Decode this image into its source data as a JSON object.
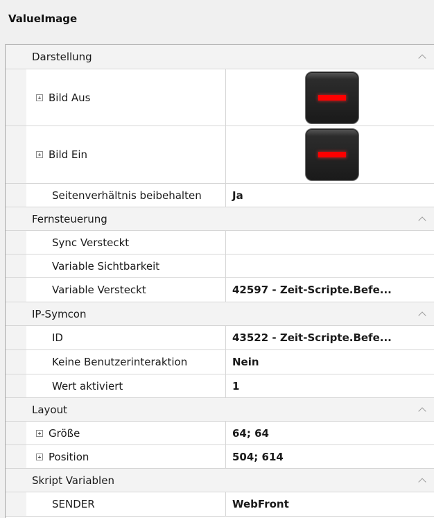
{
  "window": {
    "title": "ValueImage"
  },
  "colors": {
    "background": "#f0f0f0",
    "category_bg": "#f3f3f3",
    "grid_line": "#d6d6d6",
    "indicator": "#ff0000"
  },
  "categories": [
    {
      "label": "Darstellung",
      "properties": [
        {
          "name": "Bild Aus",
          "value": "",
          "expandable": true,
          "value_icon": "red-bar-tile-icon"
        },
        {
          "name": "Bild Ein",
          "value": "",
          "expandable": true,
          "value_icon": "red-bar-tile-icon"
        },
        {
          "name": "Seitenverhältnis beibehalten",
          "value": "Ja"
        }
      ]
    },
    {
      "label": "Fernsteuerung",
      "properties": [
        {
          "name": "Sync Versteckt",
          "value": ""
        },
        {
          "name": "Variable Sichtbarkeit",
          "value": ""
        },
        {
          "name": "Variable Versteckt",
          "value": "42597 - Zeit-Scripte.Befe..."
        }
      ]
    },
    {
      "label": "IP-Symcon",
      "properties": [
        {
          "name": "ID",
          "value": "43522 - Zeit-Scripte.Befe..."
        },
        {
          "name": "Keine Benutzerinteraktion",
          "value": "Nein"
        },
        {
          "name": "Wert aktiviert",
          "value": "1"
        }
      ]
    },
    {
      "label": "Layout",
      "properties": [
        {
          "name": "Größe",
          "value": "64; 64",
          "expandable": true
        },
        {
          "name": "Position",
          "value": "504; 614",
          "expandable": true
        }
      ]
    },
    {
      "label": "Skript Variablen",
      "properties": [
        {
          "name": "SENDER",
          "value": "WebFront"
        }
      ]
    }
  ]
}
